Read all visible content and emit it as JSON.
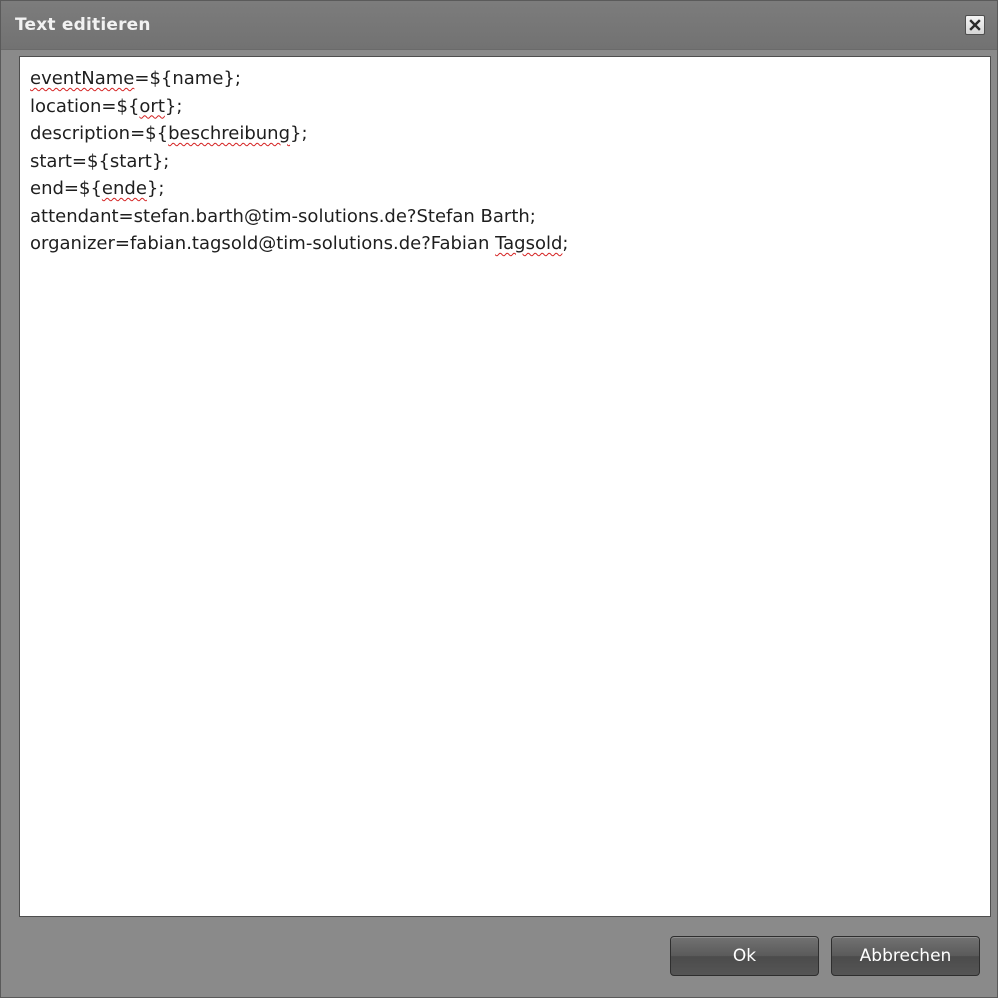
{
  "dialog": {
    "title": "Text editieren",
    "close_icon": "close-icon"
  },
  "editor": {
    "lines": [
      [
        {
          "t": "eventName",
          "spell": true
        },
        {
          "t": "=${name};"
        }
      ],
      [
        {
          "t": "location=${"
        },
        {
          "t": "ort",
          "spell": true
        },
        {
          "t": "};"
        }
      ],
      [
        {
          "t": "description=${"
        },
        {
          "t": "beschreibung",
          "spell": true
        },
        {
          "t": "};"
        }
      ],
      [
        {
          "t": "start=${start};"
        }
      ],
      [
        {
          "t": "end=${"
        },
        {
          "t": "ende",
          "spell": true
        },
        {
          "t": "};"
        }
      ],
      [
        {
          "t": "attendant=stefan.barth@tim-solutions.de?Stefan Barth;"
        }
      ],
      [
        {
          "t": "organizer=fabian.tagsold@tim-solutions.de?Fabian "
        },
        {
          "t": "Tagsold",
          "spell": true
        },
        {
          "t": ";"
        }
      ]
    ],
    "spellcheck_color": "#d42020"
  },
  "buttons": {
    "ok_label": "Ok",
    "cancel_label": "Abbrechen"
  }
}
